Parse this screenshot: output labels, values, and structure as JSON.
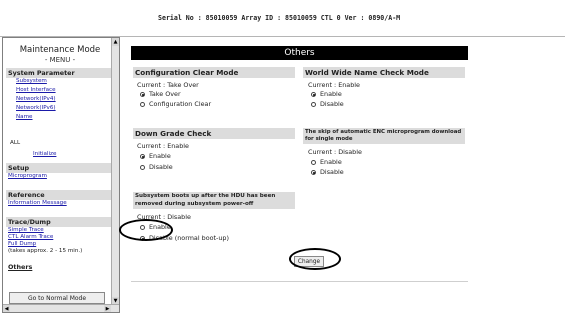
{
  "header": {
    "serial_line": "Serial No : 85010059  Array ID : 85010059  CTL 0  Ver : 0890/A-M"
  },
  "menu": {
    "title": "Maintenance Mode",
    "subtitle": "- MENU -",
    "system_parameter": {
      "heading": "System Parameter",
      "links": [
        "Subsystem",
        "Host Interface",
        "Network(IPv4)",
        "Network(IPv6)",
        "Name"
      ]
    },
    "all_label": "ALL",
    "initialize_link": "Initialize",
    "setup": {
      "heading": "Setup",
      "links": [
        "Microprogram"
      ]
    },
    "reference": {
      "heading": "Reference",
      "links": [
        "Information Message"
      ]
    },
    "trace_dump": {
      "heading": "Trace/Dump",
      "links": [
        "Simple Trace",
        "CTL Alarm Trace",
        "Full Dump"
      ],
      "note": "(takes approx. 2 - 15 min.)"
    },
    "others_label": "Others",
    "normal_mode_button": "Go to Normal Mode"
  },
  "main": {
    "title": "Others",
    "config_clear": {
      "heading": "Configuration Clear Mode",
      "current": "Current : Take Over",
      "options": [
        "Take Over",
        "Configuration Clear"
      ],
      "selected": 0
    },
    "wwn_check": {
      "heading": "World Wide Name Check Mode",
      "current": "Current : Enable",
      "options": [
        "Enable",
        "Disable"
      ],
      "selected": 0
    },
    "down_grade": {
      "heading": "Down Grade Check",
      "current": "Current : Enable",
      "options": [
        "Enable",
        "Disable"
      ],
      "selected": 0
    },
    "enc_skip": {
      "heading": "The skip of automatic ENC microprogram download for single mode",
      "current": "Current : Disable",
      "options": [
        "Enable",
        "Disable"
      ],
      "selected": 1
    },
    "hdu_boot": {
      "heading": "Subsystem boots up after the HDU has been removed during subsystem power-off",
      "current": "Current : Disable",
      "options": [
        "Enable",
        "Disable (normal boot-up)"
      ],
      "selected": 1
    },
    "change_button": "Change"
  }
}
